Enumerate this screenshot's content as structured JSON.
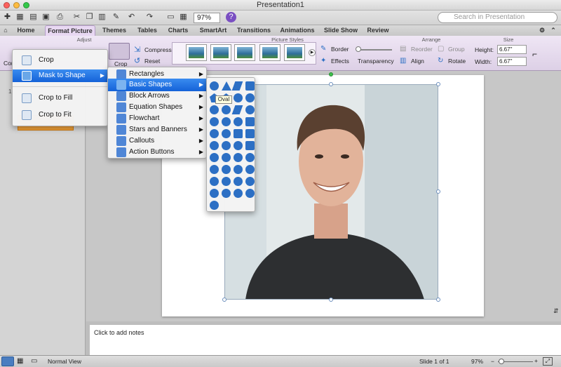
{
  "window": {
    "title": "Presentation1"
  },
  "toolbar": {
    "zoom": "97%",
    "search_placeholder": "Search in Presentation"
  },
  "ribbon_tabs": [
    "Home",
    "Format Picture",
    "Themes",
    "Tables",
    "Charts",
    "SmartArt",
    "Transitions",
    "Animations",
    "Slide Show",
    "Review"
  ],
  "ribbon": {
    "groups": {
      "adjust": "Adjust",
      "picture_styles": "Picture Styles",
      "arrange": "Arrange",
      "size": "Size"
    },
    "con_label": "Con",
    "crop_label": "Crop",
    "compress_label": "Compress",
    "reset_label": "Reset",
    "border_label": "Border",
    "effects_label": "Effects",
    "transparency_label": "Transparency",
    "reorder_label": "Reorder",
    "group_label": "Group",
    "align_label": "Align",
    "rotate_label": "Rotate",
    "height_label": "Height:",
    "height_value": "6.67\"",
    "width_label": "Width:",
    "width_value": "6.67\""
  },
  "crop_menu": {
    "items": [
      "Crop",
      "Mask to Shape",
      "Crop to Fill",
      "Crop to Fit"
    ]
  },
  "shape_menu": {
    "items": [
      "Rectangles",
      "Basic Shapes",
      "Block Arrows",
      "Equation Shapes",
      "Flowchart",
      "Stars and Banners",
      "Callouts",
      "Action Buttons"
    ]
  },
  "tooltip": "Oval",
  "thumb_number": "1",
  "notes_placeholder": "Click to add notes",
  "status": {
    "view": "Normal View",
    "slide": "Slide 1 of 1",
    "zoom": "97%"
  },
  "colors": {
    "accent_tab": "#e8d8f2",
    "menu_highlight": "#1f6fe0",
    "shape_blue": "#2c6fc4"
  }
}
